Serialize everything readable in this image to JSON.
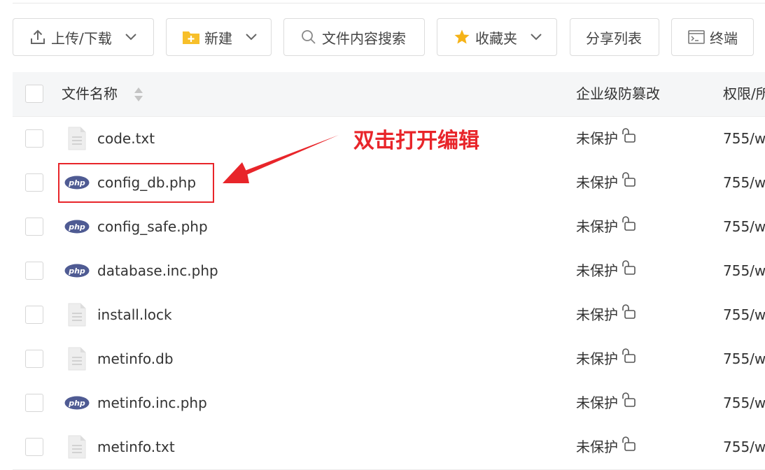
{
  "toolbar": {
    "upload_download": "上传/下载",
    "new": "新建",
    "search_content": "文件内容搜索",
    "favorites": "收藏夹",
    "share_list": "分享列表",
    "terminal": "终端"
  },
  "table": {
    "headers": {
      "name": "文件名称",
      "tamper": "企业级防篡改",
      "perm": "权限/所"
    },
    "rows": [
      {
        "name": "code.txt",
        "icon": "text-file-icon",
        "protect": "未保护",
        "perm": "755/w"
      },
      {
        "name": "config_db.php",
        "icon": "php-icon",
        "protect": "未保护",
        "perm": "755/w"
      },
      {
        "name": "config_safe.php",
        "icon": "php-icon",
        "protect": "未保护",
        "perm": "755/w"
      },
      {
        "name": "database.inc.php",
        "icon": "php-icon",
        "protect": "未保护",
        "perm": "755/w"
      },
      {
        "name": "install.lock",
        "icon": "text-file-icon",
        "protect": "未保护",
        "perm": "755/w"
      },
      {
        "name": "metinfo.db",
        "icon": "text-file-icon",
        "protect": "未保护",
        "perm": "755/w"
      },
      {
        "name": "metinfo.inc.php",
        "icon": "php-icon",
        "protect": "未保护",
        "perm": "755/w"
      },
      {
        "name": "metinfo.txt",
        "icon": "text-file-icon",
        "protect": "未保护",
        "perm": "755/w"
      }
    ]
  },
  "annotation": {
    "text": "双击打开编辑",
    "color": "#e8252a"
  },
  "php_badge_text": "php"
}
